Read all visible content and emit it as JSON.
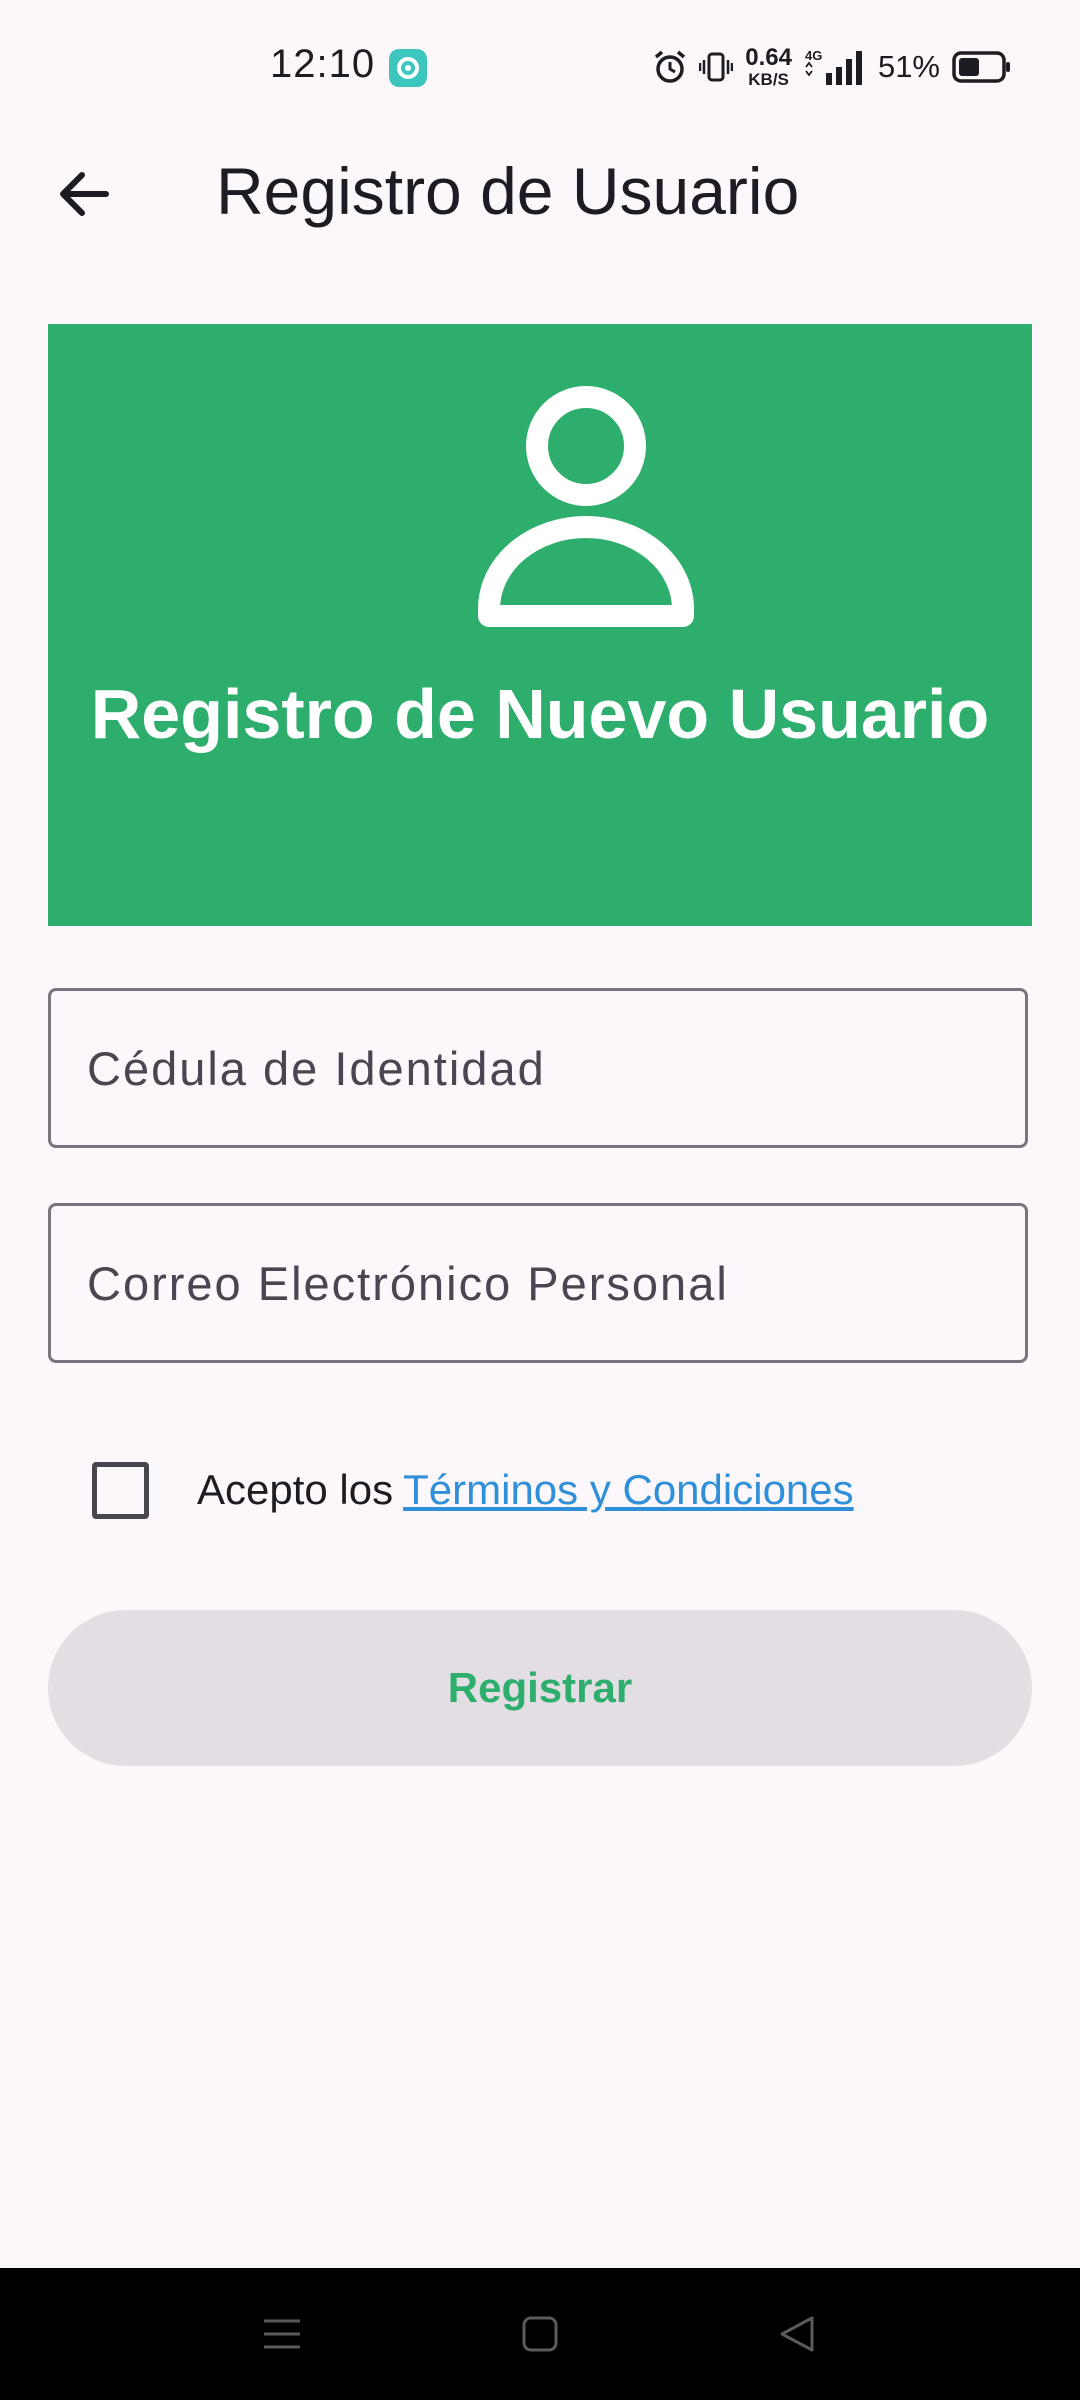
{
  "status_bar": {
    "time": "12:10",
    "network_speed_value": "0.64",
    "network_speed_unit": "KB/S",
    "network_type": "4G",
    "battery_percent": "51%",
    "battery_level": 0.51,
    "icons": [
      "app-notification-icon",
      "alarm-icon",
      "vibrate-icon",
      "signal-icon",
      "battery-icon"
    ]
  },
  "app_bar": {
    "title": "Registro de Usuario",
    "back_icon": "arrow-back-icon"
  },
  "header": {
    "icon": "person-icon",
    "title": "Registro de Nuevo Usuario",
    "background_color": "#2eae6d"
  },
  "form": {
    "cedula": {
      "placeholder": "Cédula de Identidad",
      "value": ""
    },
    "correo": {
      "placeholder": "Correo Electrónico Personal",
      "value": ""
    },
    "terms": {
      "checked": false,
      "text": "Acepto los",
      "link": "Términos y Condiciones",
      "link_color": "#2f8fd8"
    },
    "register_label": "Registrar",
    "register_text_color": "#2eae6d"
  },
  "nav_bar": {
    "icons": [
      "menu-icon",
      "home-icon",
      "back-triangle-icon"
    ]
  }
}
